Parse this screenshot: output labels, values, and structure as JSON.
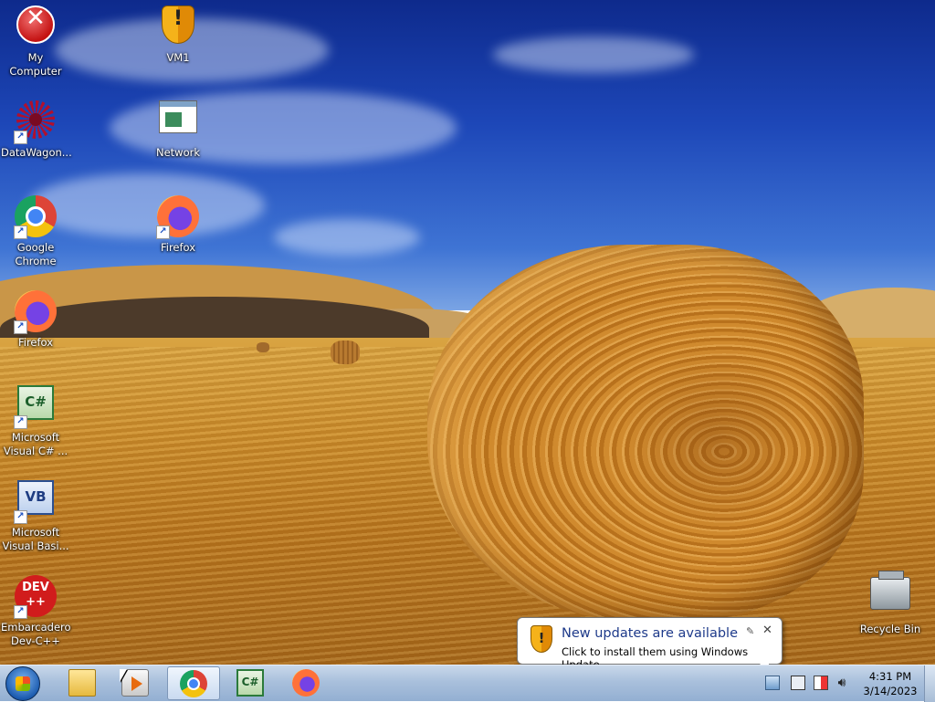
{
  "desktop": {
    "icons": [
      {
        "label": "My Computer",
        "icon": "error-icon"
      },
      {
        "label": "VM1",
        "icon": "shield-icon"
      },
      {
        "label": "DataWagon...",
        "icon": "datawagon-icon"
      },
      {
        "label": "Network",
        "icon": "network-icon"
      },
      {
        "label": "Google\nChrome",
        "icon": "chrome-icon"
      },
      {
        "label": "Firefox",
        "icon": "firefox-icon"
      },
      {
        "label": "Firefox",
        "icon": "firefox-icon"
      },
      {
        "label": "Microsoft\nVisual C# ...",
        "icon": "visual-csharp-icon",
        "glyph": "C#"
      },
      {
        "label": "Microsoft\nVisual Basi...",
        "icon": "visual-basic-icon",
        "glyph": "VB"
      },
      {
        "label": "Embarcadero\nDev-C++",
        "icon": "devcpp-icon",
        "glyph": "DEV\n++"
      },
      {
        "label": "Recycle Bin",
        "icon": "recycle-bin-icon"
      }
    ]
  },
  "notification": {
    "title": "New updates are available",
    "body": "Click to install them using Windows Update.",
    "close_glyph": "✕",
    "pin_glyph": "✎"
  },
  "taskbar": {
    "start_icon": "windows-start-icon",
    "pinned": [
      {
        "name": "Windows Explorer",
        "icon": "folder-icon"
      },
      {
        "name": "Windows Media Player",
        "icon": "media-player-icon"
      },
      {
        "name": "Google Chrome",
        "icon": "chrome-icon",
        "active": true
      },
      {
        "name": "Microsoft Visual C#",
        "icon": "visual-csharp-icon",
        "glyph": "C#"
      },
      {
        "name": "Firefox",
        "icon": "firefox-icon"
      }
    ],
    "tray_icons": [
      "windows-update-icon",
      "network-icon",
      "action-center-flag-icon",
      "volume-icon"
    ],
    "clock": {
      "time": "4:31 PM",
      "date": "3/14/2023"
    }
  }
}
